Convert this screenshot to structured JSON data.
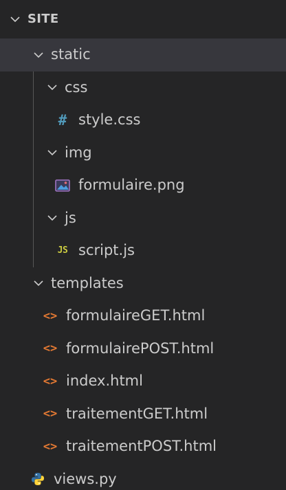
{
  "explorer": {
    "root_label": "SITE",
    "items": [
      {
        "label": "static",
        "type": "folder"
      },
      {
        "label": "css",
        "type": "folder"
      },
      {
        "label": "style.css",
        "type": "css",
        "icon": "hash-icon"
      },
      {
        "label": "img",
        "type": "folder"
      },
      {
        "label": "formulaire.png",
        "type": "image",
        "icon": "image-file-icon"
      },
      {
        "label": "js",
        "type": "folder"
      },
      {
        "label": "script.js",
        "type": "js",
        "icon": "js-file-icon",
        "icon_text": "JS"
      },
      {
        "label": "templates",
        "type": "folder"
      },
      {
        "label": "formulaireGET.html",
        "type": "html",
        "icon": "html-file-icon",
        "icon_text": "<>"
      },
      {
        "label": "formulairePOST.html",
        "type": "html",
        "icon": "html-file-icon",
        "icon_text": "<>"
      },
      {
        "label": "index.html",
        "type": "html",
        "icon": "html-file-icon",
        "icon_text": "<>"
      },
      {
        "label": "traitementGET.html",
        "type": "html",
        "icon": "html-file-icon",
        "icon_text": "<>"
      },
      {
        "label": "traitementPOST.html",
        "type": "html",
        "icon": "html-file-icon",
        "icon_text": "<>"
      },
      {
        "label": "views.py",
        "type": "python",
        "icon": "python-file-icon"
      }
    ],
    "selected": "static"
  },
  "colors": {
    "background": "#252526",
    "selected_row": "#37373d",
    "text": "#cccccc",
    "css_icon": "#519aba",
    "html_icon": "#e37933",
    "js_icon": "#cbcb41",
    "python_blue": "#3572a5",
    "python_yellow": "#ffd43b"
  }
}
